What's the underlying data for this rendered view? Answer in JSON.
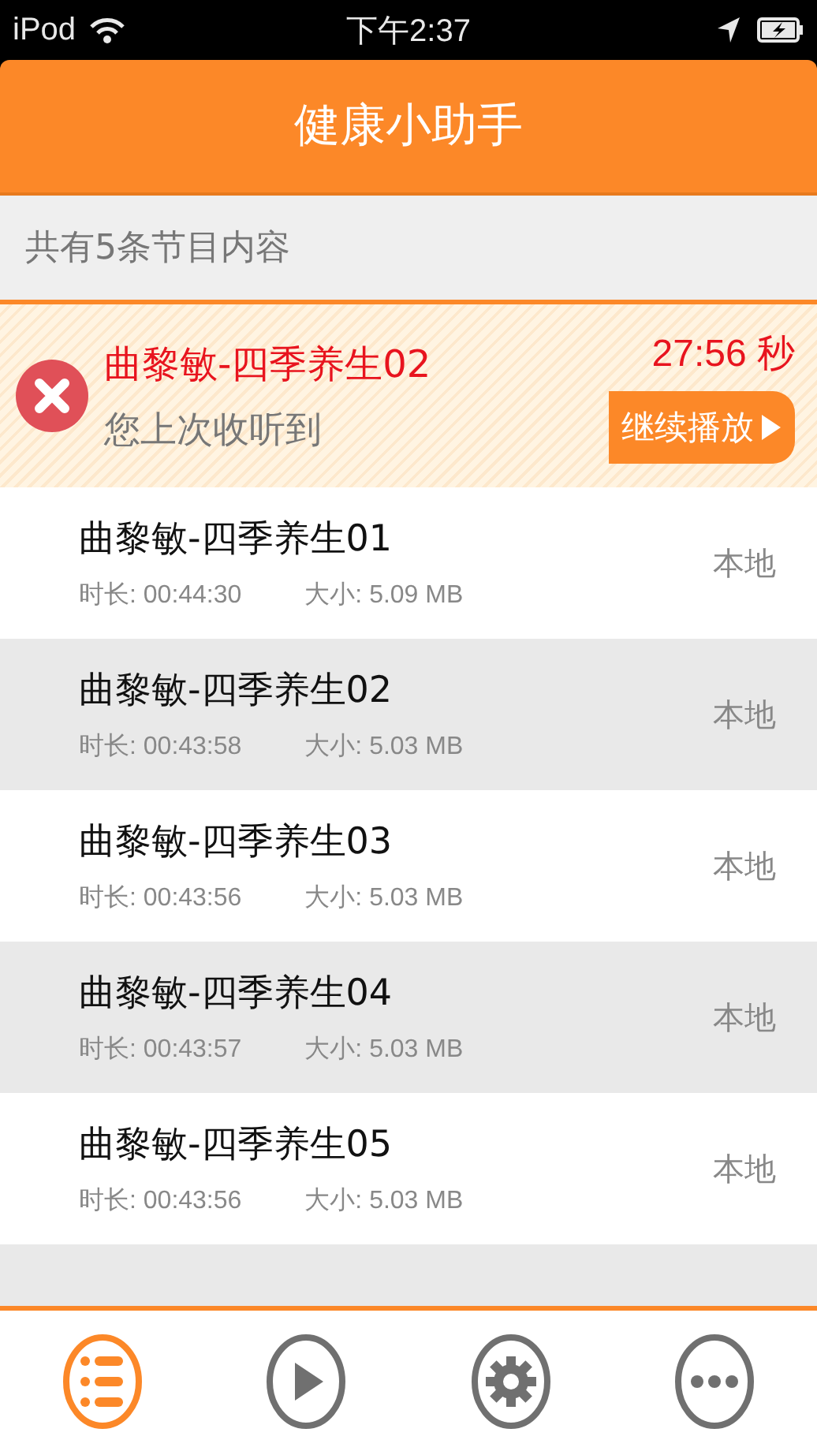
{
  "status_bar": {
    "device": "iPod",
    "time": "下午2:37"
  },
  "header": {
    "title": "健康小助手"
  },
  "summary": "共有5条节目内容",
  "resume": {
    "title": "曲黎敏-四季养生02",
    "subtitle": "您上次收听到",
    "position": "27:56 秒",
    "button": "继续播放"
  },
  "episodes": [
    {
      "title": "曲黎敏-四季养生01",
      "duration": "时长: 00:44:30",
      "size": "大小: 5.09 MB",
      "source": "本地"
    },
    {
      "title": "曲黎敏-四季养生02",
      "duration": "时长: 00:43:58",
      "size": "大小: 5.03 MB",
      "source": "本地"
    },
    {
      "title": "曲黎敏-四季养生03",
      "duration": "时长: 00:43:56",
      "size": "大小: 5.03 MB",
      "source": "本地"
    },
    {
      "title": "曲黎敏-四季养生04",
      "duration": "时长: 00:43:57",
      "size": "大小: 5.03 MB",
      "source": "本地"
    },
    {
      "title": "曲黎敏-四季养生05",
      "duration": "时长: 00:43:56",
      "size": "大小: 5.03 MB",
      "source": "本地"
    }
  ],
  "tab_bar": [
    {
      "kind": "list",
      "selected": true
    },
    {
      "kind": "play",
      "selected": false
    },
    {
      "kind": "settings",
      "selected": false
    },
    {
      "kind": "more",
      "selected": false
    }
  ]
}
